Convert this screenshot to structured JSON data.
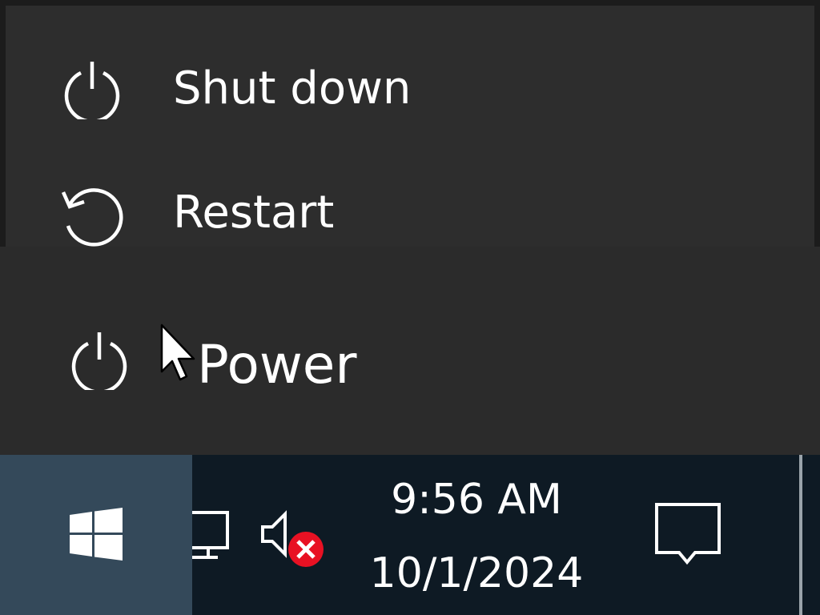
{
  "power_submenu": {
    "items": [
      {
        "label": "Shut down",
        "icon": "power-icon"
      },
      {
        "label": "Restart",
        "icon": "restart-icon"
      }
    ]
  },
  "start_menu": {
    "power_button": {
      "label": "Power",
      "icon": "power-icon"
    }
  },
  "taskbar": {
    "start_icon": "windows-logo-icon",
    "tray": {
      "network_icon": "network-icon",
      "volume_icon": "volume-muted-icon",
      "volume_status": "error"
    },
    "clock": {
      "time": "9:56 AM",
      "date": "10/1/2024"
    },
    "notification_icon": "action-center-icon"
  },
  "colors": {
    "menu_bg": "#2d2d2d",
    "taskbar_bg": "#0e1a24",
    "start_button_bg": "#34495a",
    "text": "#ffffff",
    "error_badge": "#e81123"
  }
}
